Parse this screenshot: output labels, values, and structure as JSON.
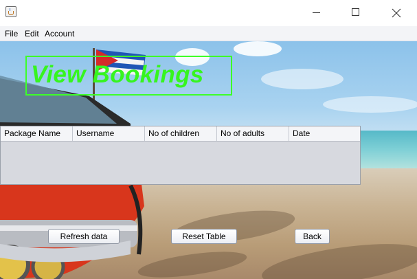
{
  "window": {
    "app_icon": "java-coffee-cup-icon",
    "controls": [
      "minimize-icon",
      "maximize-icon",
      "close-icon"
    ]
  },
  "menu": {
    "items": [
      "File",
      "Edit",
      "Account"
    ]
  },
  "heading": {
    "title": "View Bookings",
    "color": "#36f51f",
    "border_color": "#3dff28"
  },
  "table": {
    "columns": [
      "Package Name",
      "Username",
      "No of children",
      "No of adults",
      "Date"
    ],
    "rows": []
  },
  "buttons": {
    "refresh_label": "Refresh data",
    "reset_label": "Reset Table",
    "back_label": "Back"
  }
}
